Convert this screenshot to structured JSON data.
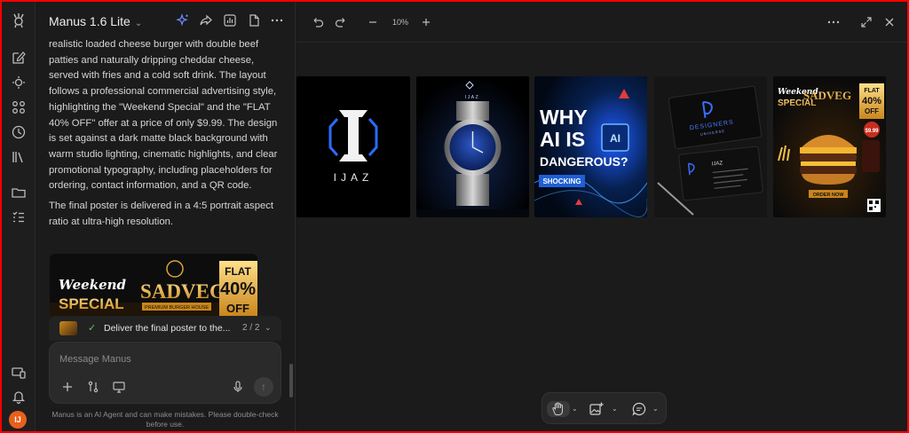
{
  "app": {
    "title": "Manus 1.6 Lite"
  },
  "user": {
    "initials": "IJ",
    "color": "#e8601c"
  },
  "rail": {
    "icons": [
      "logo-icon",
      "new-task-icon",
      "agent-icon",
      "apps-icon",
      "history-icon",
      "library-icon",
      "folder-icon",
      "tasks-icon",
      "devices-icon",
      "bell-icon"
    ]
  },
  "chat": {
    "paragraph_1": "realistic loaded cheese burger with double beef patties and naturally dripping cheddar cheese, served with fries and a cold soft drink. The layout follows a professional commercial advertising style, highlighting the \"Weekend Special\" and the \"FLAT 40% OFF\" offer at a price of only $9.99. The design is set against a dark matte black background with warm studio lighting, cinematic highlights, and clear promotional typography, including placeholders for ordering, contact information, and a QR code.",
    "paragraph_2": "The final poster is delivered in a 4:5 portrait aspect ratio at ultra-high resolution.",
    "poster_preview": {
      "weekend": "Weekend",
      "special": "SPECIAL",
      "brand": "SADVEG",
      "tagline": "PREMIUM BURGER HOUSE",
      "flat": "FLAT",
      "percent": "40%",
      "off": "OFF"
    }
  },
  "task_progress": {
    "label": "Deliver the final poster to the...",
    "count": "2 / 2"
  },
  "composer": {
    "placeholder": "Message Manus"
  },
  "disclaimer": "Manus is an AI Agent and can make mistakes. Please double-check before use.",
  "canvas": {
    "zoom": "10%",
    "cards": {
      "logo": {
        "text": "IJAZ"
      },
      "watch": {
        "brand": "IJAZ"
      },
      "ai": {
        "line1": "WHY",
        "line2": "AI IS",
        "line3": "DANGEROUS?",
        "badge": "SHOCKING",
        "chip": "AI"
      },
      "business": {
        "name": "DESIGNERS",
        "sub": "UNIVERSE",
        "person": "IJAZ"
      },
      "burger": {
        "weekend": "Weekend",
        "special": "SPECIAL",
        "brand": "SADVEG",
        "flat": "FLAT",
        "percent": "40%",
        "off": "OFF",
        "price": "$9.99",
        "order": "ORDER NOW"
      }
    }
  },
  "colors": {
    "accent_blue": "#6b8cff",
    "success": "#5cc46d",
    "border": "#ff0000"
  }
}
